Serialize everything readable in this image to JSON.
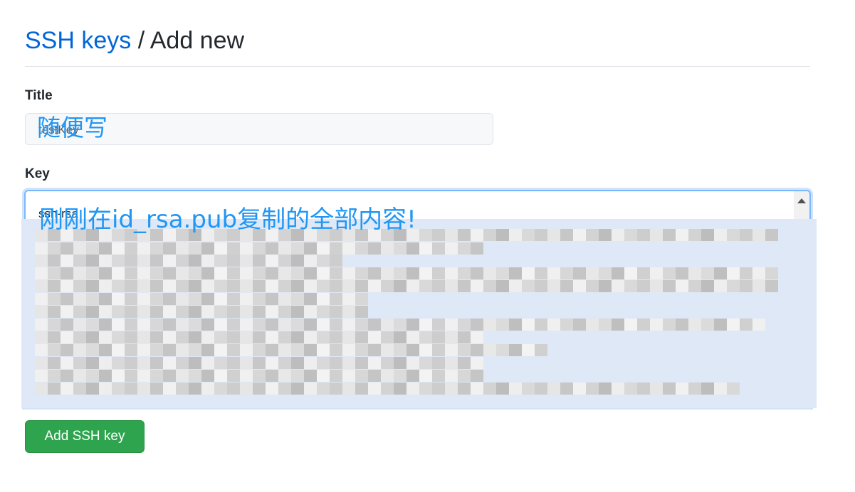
{
  "breadcrumb": {
    "link": "SSH keys",
    "separator": " / ",
    "current": "Add new"
  },
  "form": {
    "title_label": "Title",
    "title_value": "testKey",
    "key_label": "Key",
    "key_value": "ssh-rsa",
    "submit_label": "Add SSH key"
  },
  "annotations": {
    "title_note": "随便写",
    "key_note": "刚刚在id_rsa.pub复制的全部内容!"
  },
  "colors": {
    "link": "#0366d6",
    "annotation": "#2196f3",
    "button": "#2ea44f",
    "focus_border": "#79b8ff"
  }
}
